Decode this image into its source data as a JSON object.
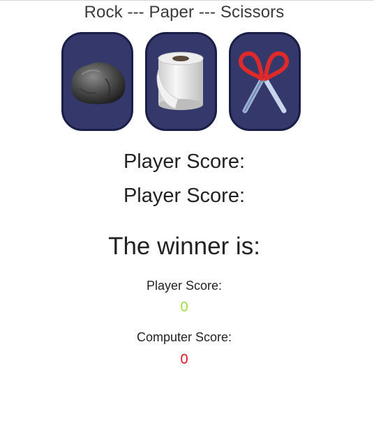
{
  "title": "Rock --- Paper --- Scissors",
  "choices": [
    {
      "name": "rock",
      "icon": "rock-icon"
    },
    {
      "name": "paper",
      "icon": "toilet-paper-icon"
    },
    {
      "name": "scissors",
      "icon": "scissors-icon"
    }
  ],
  "player_choice_label": "Player Score:",
  "computer_choice_label": "Player Score:",
  "winner_label": "The winner is:",
  "scores": {
    "player_label": "Player Score:",
    "player_value": "0",
    "player_color": "#9be03a",
    "computer_label": "Computer Score:",
    "computer_value": "0",
    "computer_color": "#e0141b"
  },
  "colors": {
    "card_bg": "#34386a",
    "card_border": "#1b1f48"
  }
}
